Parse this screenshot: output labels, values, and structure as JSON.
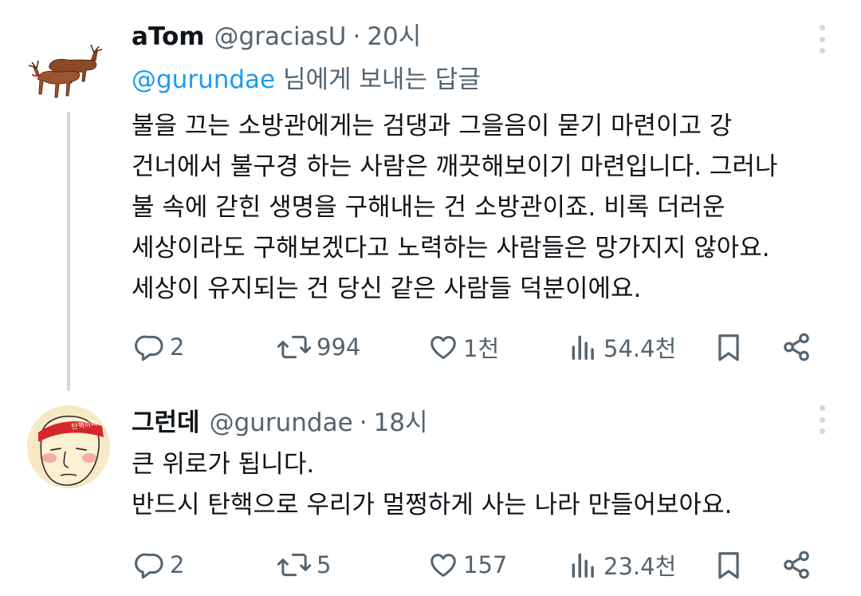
{
  "tweets": [
    {
      "display_name": "aTom",
      "handle": "@graciasU",
      "separator": "·",
      "time": "20시",
      "reply_mention": "@gurundae",
      "reply_suffix": "님에게 보내는 답글",
      "lines": [
        "불을 끄는 소방관에게는 검댕과 그을음이 묻기 마련이고 강",
        "건너에서 불구경 하는 사람은 깨끗해보이기 마련입니다. 그러나",
        "불 속에 갇힌 생명을 구해내는 건 소방관이죠. 비록 더러운",
        "세상이라도 구해보겠다고 노력하는 사람들은 망가지지 않아요.",
        "세상이 유지되는 건 당신 같은 사람들 덕분이에요."
      ],
      "stats": {
        "replies": "2",
        "retweets": "994",
        "likes": "1천",
        "views": "54.4천"
      }
    },
    {
      "display_name": "그런데",
      "handle": "@gurundae",
      "separator": "·",
      "time": "18시",
      "avatar_text": "탄핵하라",
      "lines": [
        "큰 위로가 됩니다.",
        "반드시 탄핵으로 우리가 멀쩡하게 사는 나라 만들어보아요."
      ],
      "stats": {
        "replies": "2",
        "retweets": "5",
        "likes": "157",
        "views": "23.4천"
      }
    }
  ],
  "icons": {
    "reply": "reply-icon",
    "retweet": "retweet-icon",
    "like": "heart-icon",
    "views": "views-chart-icon",
    "bookmark": "bookmark-icon",
    "share": "share-icon",
    "more": "more-vertical-icon"
  },
  "colors": {
    "text": "#0f1419",
    "secondary": "#536471",
    "mention": "#1d9bf0",
    "thread_line": "#cfd9de"
  }
}
